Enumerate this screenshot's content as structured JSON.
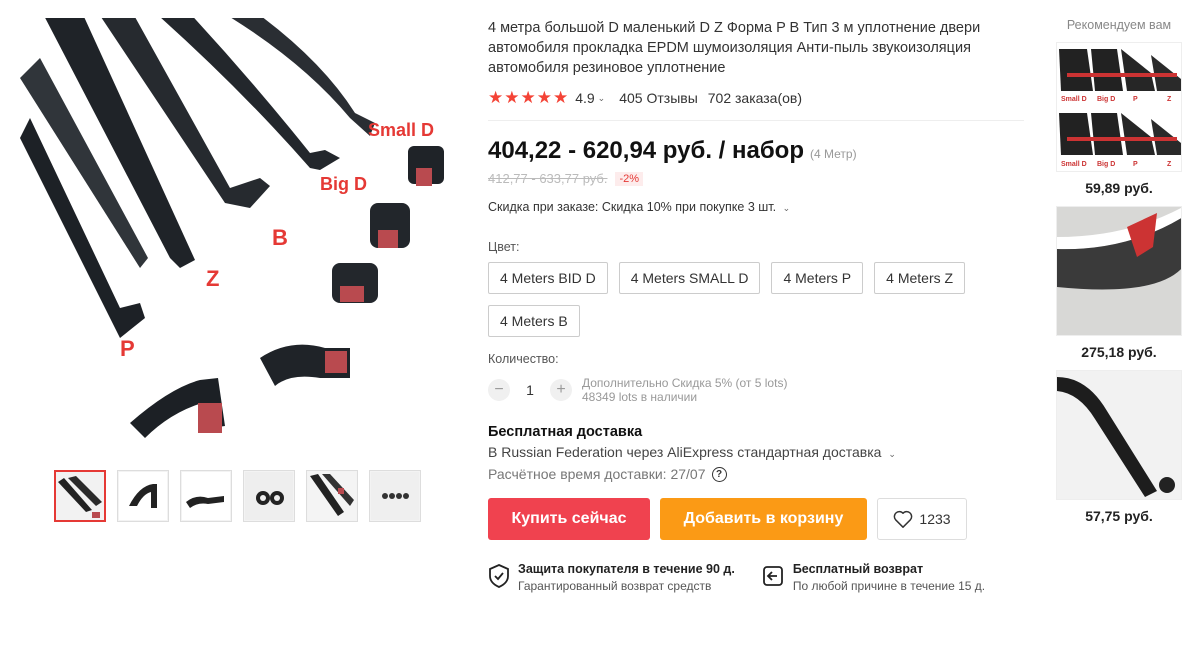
{
  "product": {
    "title": "4 метра большой D маленький D Z Форма P B Тип 3 м уплотнение двери автомобиля прокладка EPDM шумоизоляция Анти-пыль звукоизоляция автомобиля резиновое уплотнение",
    "rating": "4.9",
    "reviews": "405 Отзывы",
    "orders": "702 заказа(ов)",
    "price": "404,22 - 620,94 руб. / набор",
    "price_unit": "(4 Метр)",
    "old_price": "412,77 - 633,77 руб.",
    "discount": "-2%",
    "promo": "Скидка при заказе: Скидка 10% при покупке 3 шт."
  },
  "image_labels": {
    "small_d": "Small D",
    "big_d": "Big D",
    "b": "B",
    "z": "Z",
    "p": "P"
  },
  "color": {
    "label": "Цвет:",
    "options": [
      "4 Meters BID D",
      "4 Meters SMALL D",
      "4 Meters P",
      "4 Meters Z",
      "4 Meters B"
    ]
  },
  "quantity": {
    "label": "Количество:",
    "value": "1",
    "minus": "−",
    "plus": "+",
    "extra_discount": "Дополнительно Скидка 5% (от 5 lots)",
    "stock": "48349 lots в наличии"
  },
  "shipping": {
    "title": "Бесплатная доставка",
    "line": "В Russian Federation через AliExpress стандартная доставка",
    "eta": "Расчётное время доставки: 27/07"
  },
  "actions": {
    "buy": "Купить сейчас",
    "cart": "Добавить в корзину",
    "wishlist_count": "1233"
  },
  "guarantees": [
    {
      "title": "Защита покупателя в течение 90 д.",
      "sub": "Гарантированный возврат средств"
    },
    {
      "title": "Бесплатный возврат",
      "sub": "По любой причине в течение 15 д."
    }
  ],
  "recommend": {
    "title": "Рекомендуем вам",
    "items": [
      {
        "price": "59,89 руб.",
        "labels": [
          "Small D",
          "Big D",
          "P",
          "Z"
        ]
      },
      {
        "price": "275,18 руб."
      },
      {
        "price": "57,75 руб."
      }
    ]
  },
  "colors": {
    "buy": "#f0424f",
    "cart": "#fb9a15",
    "accent": "#e53935"
  }
}
